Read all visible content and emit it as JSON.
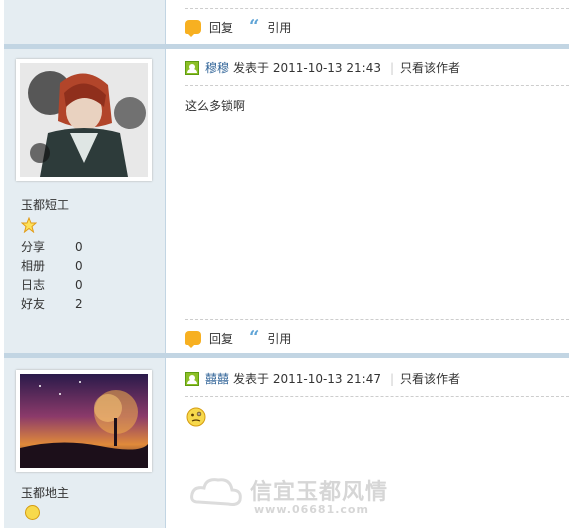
{
  "posts": [
    {
      "actions": {
        "reply": "回复",
        "quote": "引用"
      }
    },
    {
      "user": {
        "name": "玉都短工",
        "rank_icon": "star-icon",
        "stats": [
          {
            "label": "分享",
            "value": "0"
          },
          {
            "label": "相册",
            "value": "0"
          },
          {
            "label": "日志",
            "value": "0"
          },
          {
            "label": "好友",
            "value": "2"
          }
        ]
      },
      "author": "穆穆",
      "posted_text": "发表于 2011-10-13 21:43",
      "only_author": "只看该作者",
      "content": "这么多锁啊",
      "actions": {
        "reply": "回复",
        "quote": "引用"
      }
    },
    {
      "user": {
        "name": "玉都地主",
        "rank_icon": "smiley-icon"
      },
      "author": "囍囍",
      "posted_text": "发表于 2011-10-13 21:47",
      "only_author": "只看该作者",
      "content_emoticon": "thinking-smiley-icon"
    }
  ],
  "watermark": {
    "text": "信宜玉都风情",
    "url": "www.06681.com"
  },
  "colors": {
    "sidebar": "#e5edf2",
    "separator": "#c2d5e3",
    "link": "#336699",
    "reply_icon": "#f7b021",
    "quote_icon": "#5fa4d6"
  }
}
